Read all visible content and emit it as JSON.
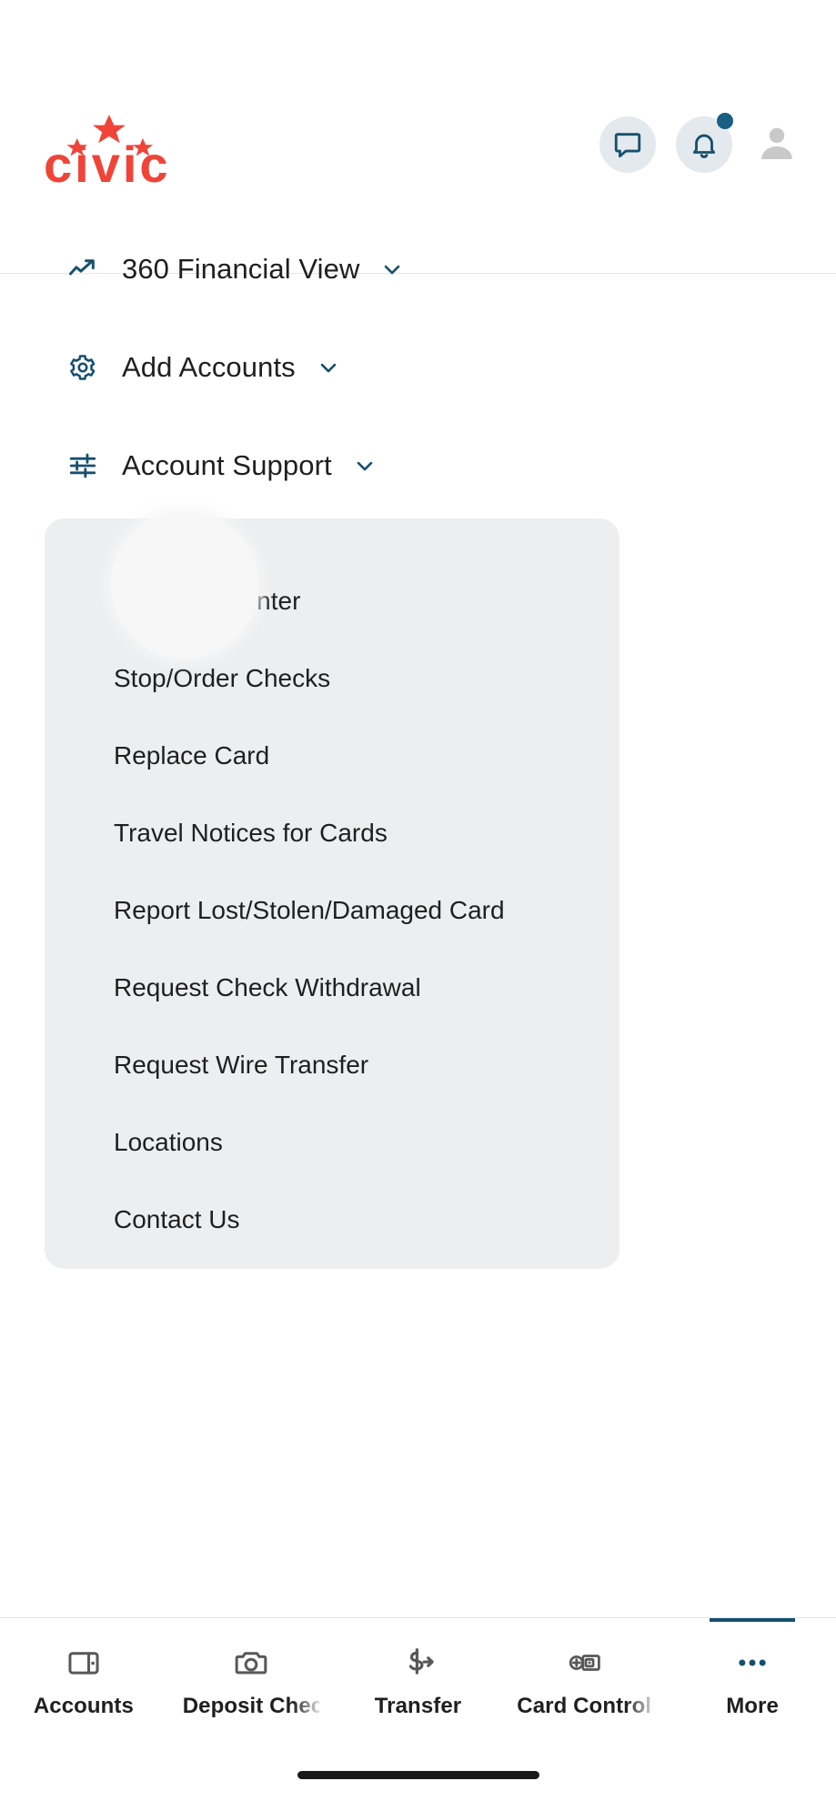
{
  "brand": {
    "name": "civic",
    "logo_color": "#f04438",
    "accent_color": "#17506e",
    "icon_bg_color": "#e3e9ec",
    "card_bg_color": "#eceef0"
  },
  "header": {
    "logo_text": "civic",
    "actions": [
      {
        "name": "messages",
        "icon": "chat-bubble-icon",
        "badge": false
      },
      {
        "name": "notifications",
        "icon": "bell-icon",
        "badge": true
      },
      {
        "name": "profile",
        "icon": "person-avatar-icon",
        "badge": false
      }
    ]
  },
  "menu": {
    "sections": [
      {
        "label": "360 Financial View",
        "icon": "trending-up-icon",
        "expanded": false
      },
      {
        "label": "Add Accounts",
        "icon": "gear-icon",
        "expanded": false
      },
      {
        "label": "Account Support",
        "icon": "tune-sliders-icon",
        "expanded": true
      }
    ]
  },
  "submenu": {
    "parent": "Account Support",
    "items": [
      {
        "label": "Message Center",
        "highlighted": true
      },
      {
        "label": "Stop/Order Checks",
        "highlighted": false
      },
      {
        "label": "Replace Card",
        "highlighted": false
      },
      {
        "label": "Travel Notices for Cards",
        "highlighted": false
      },
      {
        "label": "Report Lost/Stolen/Damaged Card",
        "highlighted": false
      },
      {
        "label": "Request Check Withdrawal",
        "highlighted": false
      },
      {
        "label": "Request Wire Transfer",
        "highlighted": false
      },
      {
        "label": "Locations",
        "highlighted": false
      },
      {
        "label": "Contact Us",
        "highlighted": false
      }
    ]
  },
  "bottom_nav": {
    "items": [
      {
        "label": "Accounts",
        "icon": "wallet-icon",
        "active": false,
        "clipped": false
      },
      {
        "label": "Deposit Check",
        "icon": "camera-icon",
        "active": false,
        "clipped": true
      },
      {
        "label": "Transfer",
        "icon": "dollar-arrow-icon",
        "active": false,
        "clipped": false
      },
      {
        "label": "Card Controls",
        "icon": "card-money-icon",
        "active": false,
        "clipped": true
      },
      {
        "label": "More",
        "icon": "ellipsis-icon",
        "active": true,
        "clipped": false
      }
    ]
  }
}
